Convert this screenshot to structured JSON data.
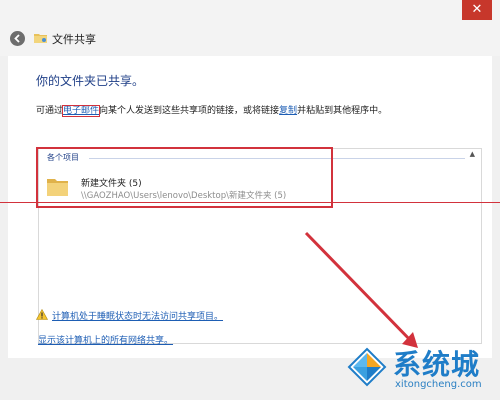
{
  "titlebar": {
    "close_glyph": "✕"
  },
  "header": {
    "back_icon": "back-arrow-icon",
    "title": "文件共享"
  },
  "main": {
    "heading": "你的文件夹已共享。",
    "desc_before": "可通过",
    "email_link": "电子邮件",
    "desc_middle": "向某个人发送到这些共享项的链接，或将链接",
    "copy_link": "复制",
    "desc_after": "并粘贴到其他程序中。"
  },
  "items": {
    "header": "各个项目",
    "caret": "▲",
    "list": [
      {
        "name": "新建文件夹 (5)",
        "path": "\\\\GAOZHAO\\Users\\lenovo\\Desktop\\新建文件夹 (5)"
      }
    ]
  },
  "footer": {
    "warning": "计算机处于睡眠状态时无法访问共享项目。",
    "all_shares": "显示该计算机上的所有网络共享。"
  },
  "watermark": {
    "brand": "系统城",
    "url": "xitongcheng.com"
  },
  "colors": {
    "accent": "#1e5eb4",
    "annotation": "#d2323c",
    "close": "#c7372b"
  }
}
